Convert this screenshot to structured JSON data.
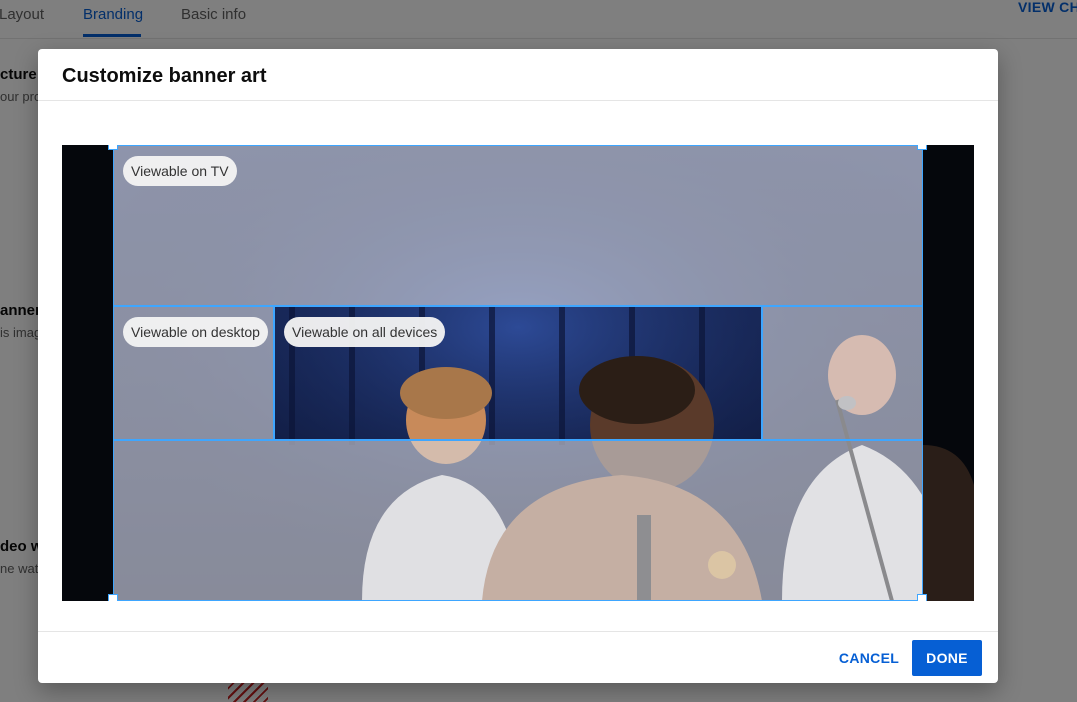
{
  "background": {
    "tabs": [
      "Layout",
      "Branding",
      "Basic info"
    ],
    "view_channel": "VIEW CHA",
    "sections": [
      {
        "title": "cture",
        "subtitle": "our prof"
      },
      {
        "title": "anner",
        "subtitle": "is imag"
      },
      {
        "title": "deo w",
        "subtitle": "ne wate"
      }
    ]
  },
  "dialog": {
    "title": "Customize banner art",
    "zones": {
      "tv": "Viewable on TV",
      "desktop": "Viewable on desktop",
      "all_devices": "Viewable on all devices"
    },
    "buttons": {
      "cancel": "CANCEL",
      "done": "DONE"
    }
  },
  "colors": {
    "accent": "#065fd4",
    "crop_line": "#3ea6ff"
  }
}
